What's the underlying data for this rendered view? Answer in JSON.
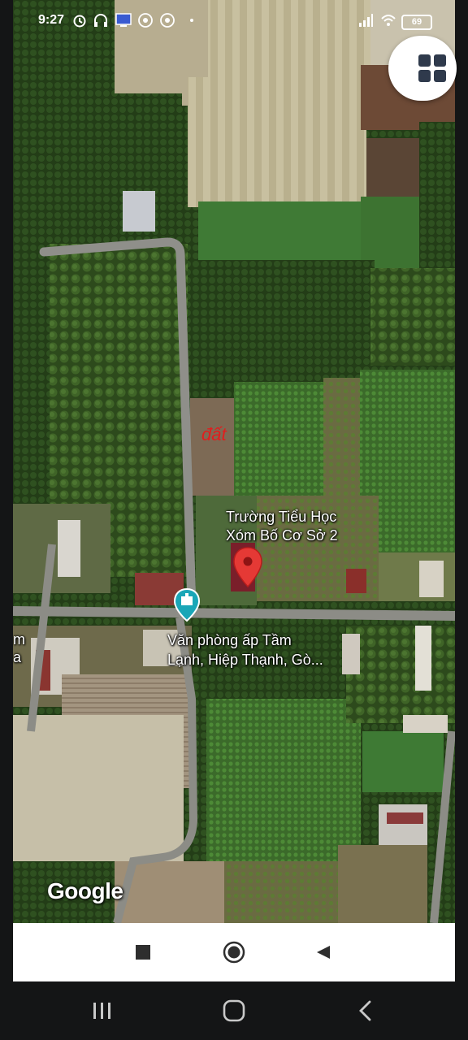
{
  "status_bar": {
    "time": "9:27",
    "battery": "69",
    "left_icons": [
      "alarm-icon",
      "headphones-icon",
      "screen-cast-icon",
      "app-notification-icon",
      "app-notification-icon",
      "dot-icon"
    ],
    "right_icons": [
      "signal-icon",
      "wifi-icon",
      "battery-icon"
    ]
  },
  "map": {
    "type": "satellite",
    "annotation": "đất",
    "place_school": {
      "line1": "Trường Tiểu Học",
      "line2": "Xóm Bố Cơ Sở 2",
      "marker": "red-pin-icon",
      "marker_color": "#e53935"
    },
    "place_office": {
      "line1": "Văn phòng ấp Tầm",
      "line2": "Lạnh, Hiệp Thạnh, Gò...",
      "marker": "landmark-pin-icon",
      "marker_color": "#1aa6b7"
    },
    "edge_label": {
      "line1": "m",
      "line2": "a"
    },
    "attribution": "Google",
    "layers_button_icon": "grid-icon"
  },
  "map_nav": {
    "buttons": [
      "stop-square-icon",
      "record-circle-icon",
      "back-triangle-icon"
    ]
  },
  "system_nav": {
    "buttons": [
      "recent-apps-icon",
      "home-icon",
      "back-chevron-icon"
    ]
  }
}
